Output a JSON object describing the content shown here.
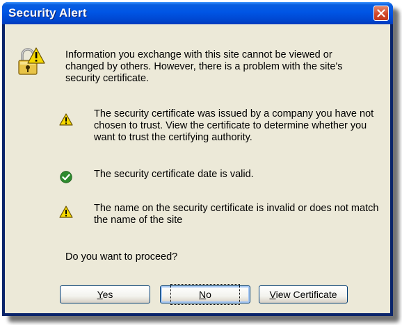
{
  "window": {
    "title": "Security Alert"
  },
  "message": {
    "intro": "Information you exchange with this site cannot be viewed or changed by others. However, there is a problem with the site's security certificate."
  },
  "items": [
    {
      "icon": "warning-icon",
      "text": "The security certificate was issued by a company you have not chosen to trust. View the certificate to determine whether you want to trust the certifying authority."
    },
    {
      "icon": "check-icon",
      "text": "The security certificate date is valid."
    },
    {
      "icon": "warning-icon",
      "text": "The name on the security certificate is invalid or does not match the name of the site"
    }
  ],
  "question": "Do you want to proceed?",
  "buttons": {
    "yes": {
      "mnemonic": "Y",
      "rest": "es"
    },
    "no": {
      "mnemonic": "N",
      "rest": "o"
    },
    "view_certificate": {
      "mnemonic": "V",
      "rest": "iew Certificate"
    }
  },
  "colors": {
    "titlebar": "#0055e5",
    "client": "#ece9d8",
    "close": "#d2482a",
    "check": "#2e8b2e",
    "warning": "#f5d800"
  }
}
